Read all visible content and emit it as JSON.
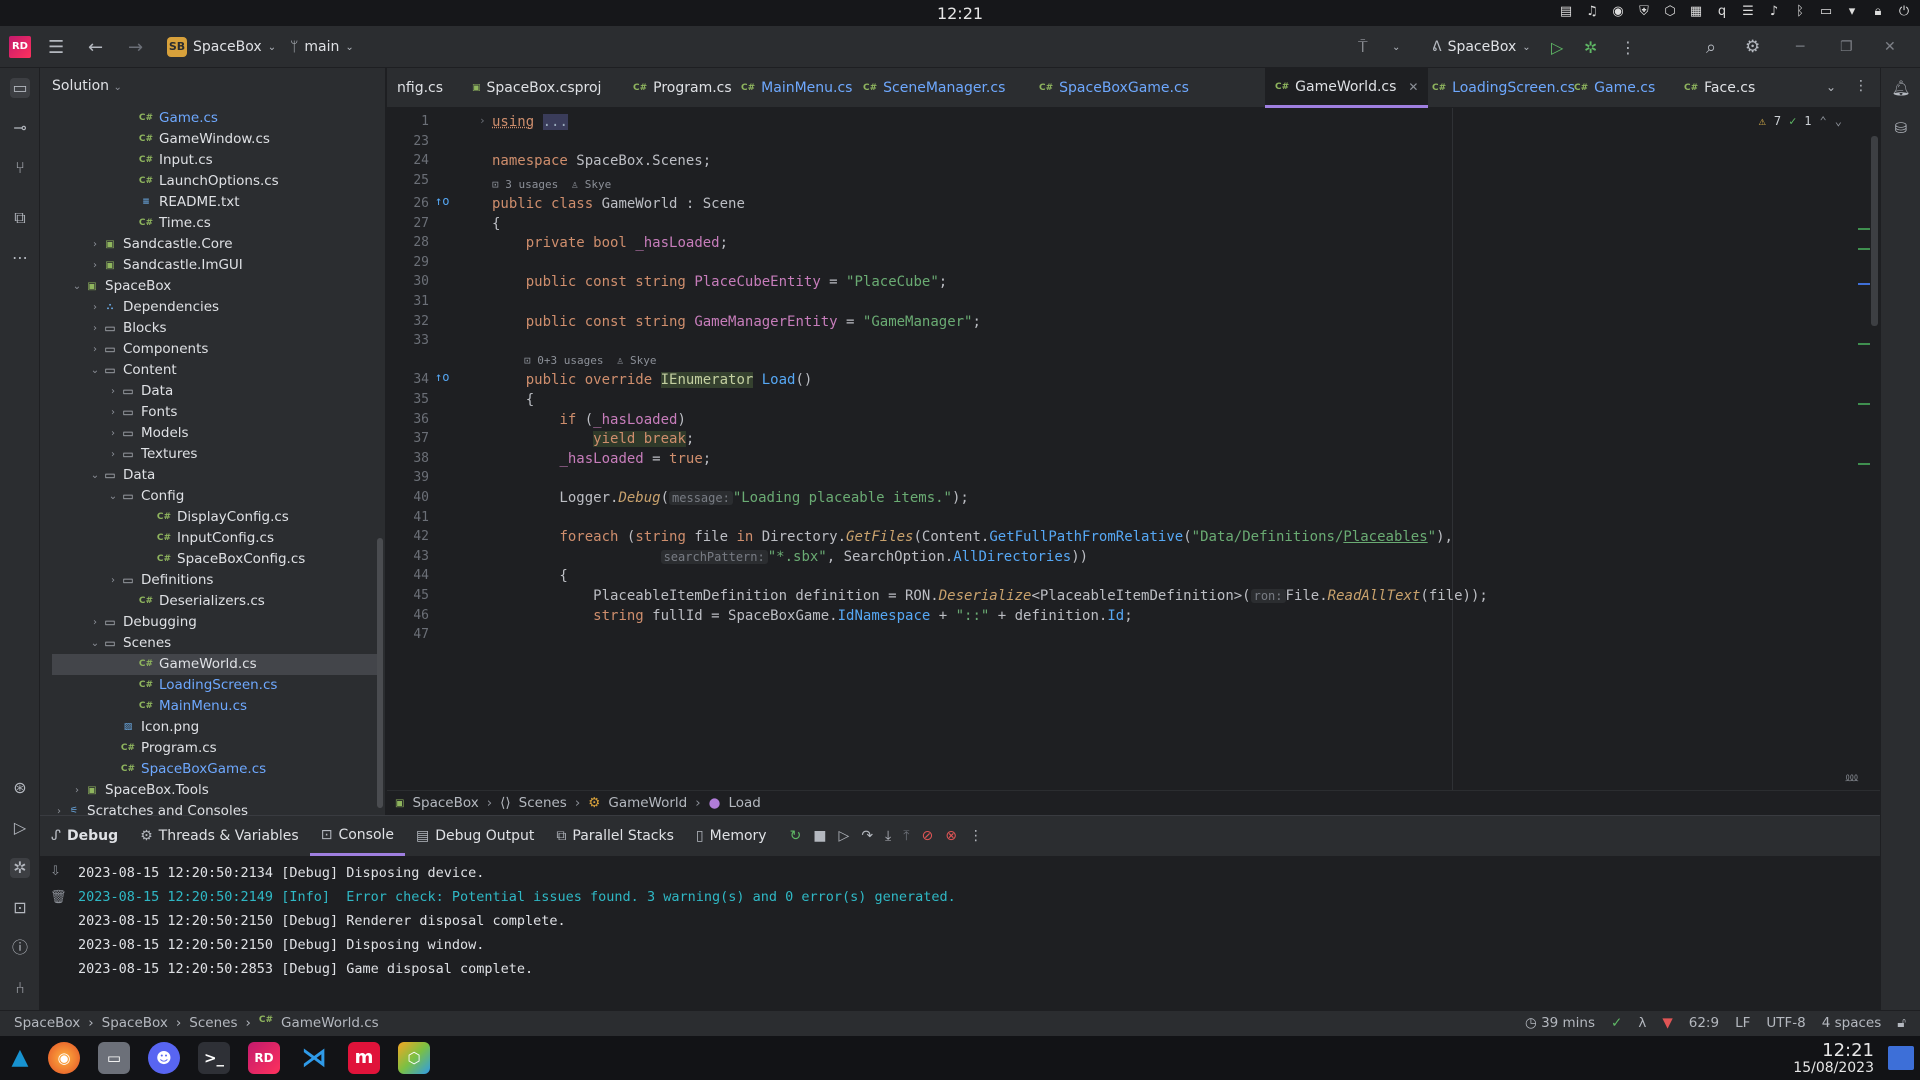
{
  "system": {
    "clock": "12:21"
  },
  "toolbar": {
    "app_logo": "RD",
    "project_badge": "SB",
    "project_name": "SpaceBox",
    "branch": "main",
    "run_config": "SpaceBox"
  },
  "solution": {
    "header": "Solution",
    "items": [
      {
        "label": "Game.cs",
        "type": "cs",
        "level": 3,
        "blue": true
      },
      {
        "label": "GameWindow.cs",
        "type": "cs",
        "level": 3
      },
      {
        "label": "Input.cs",
        "type": "cs",
        "level": 3
      },
      {
        "label": "LaunchOptions.cs",
        "type": "cs",
        "level": 3
      },
      {
        "label": "README.txt",
        "type": "txt",
        "level": 3
      },
      {
        "label": "Time.cs",
        "type": "cs",
        "level": 3
      },
      {
        "label": "Sandcastle.Core",
        "type": "proj",
        "level": 1,
        "chev": "right"
      },
      {
        "label": "Sandcastle.ImGUI",
        "type": "proj",
        "level": 1,
        "chev": "right"
      },
      {
        "label": "SpaceBox",
        "type": "proj",
        "level": 0,
        "chev": "down"
      },
      {
        "label": "Dependencies",
        "type": "deps",
        "level": 1,
        "chev": "right"
      },
      {
        "label": "Blocks",
        "type": "folder",
        "level": 1,
        "chev": "right"
      },
      {
        "label": "Components",
        "type": "folder",
        "level": 1,
        "chev": "right"
      },
      {
        "label": "Content",
        "type": "folder",
        "level": 1,
        "chev": "down"
      },
      {
        "label": "Data",
        "type": "folder",
        "level": 2,
        "chev": "right"
      },
      {
        "label": "Fonts",
        "type": "folder",
        "level": 2,
        "chev": "right"
      },
      {
        "label": "Models",
        "type": "folder",
        "level": 2,
        "chev": "right"
      },
      {
        "label": "Textures",
        "type": "folder",
        "level": 2,
        "chev": "right"
      },
      {
        "label": "Data",
        "type": "folder",
        "level": 1,
        "chev": "down"
      },
      {
        "label": "Config",
        "type": "folder",
        "level": 2,
        "chev": "down"
      },
      {
        "label": "DisplayConfig.cs",
        "type": "cs",
        "level": 4
      },
      {
        "label": "InputConfig.cs",
        "type": "cs",
        "level": 4
      },
      {
        "label": "SpaceBoxConfig.cs",
        "type": "cs",
        "level": 4
      },
      {
        "label": "Definitions",
        "type": "folder",
        "level": 2,
        "chev": "right"
      },
      {
        "label": "Deserializers.cs",
        "type": "cs",
        "level": 3
      },
      {
        "label": "Debugging",
        "type": "folder",
        "level": 1,
        "chev": "right"
      },
      {
        "label": "Scenes",
        "type": "folder",
        "level": 1,
        "chev": "down"
      },
      {
        "label": "GameWorld.cs",
        "type": "cs",
        "level": 3,
        "selected": true
      },
      {
        "label": "LoadingScreen.cs",
        "type": "cs",
        "level": 3,
        "blue": true
      },
      {
        "label": "MainMenu.cs",
        "type": "cs",
        "level": 3,
        "blue": true
      },
      {
        "label": "Icon.png",
        "type": "img",
        "level": 2
      },
      {
        "label": "Program.cs",
        "type": "cs",
        "level": 2
      },
      {
        "label": "SpaceBoxGame.cs",
        "type": "cs",
        "level": 2,
        "blue": true
      },
      {
        "label": "SpaceBox.Tools",
        "type": "proj",
        "level": 0,
        "chev": "right"
      },
      {
        "label": "Scratches and Consoles",
        "type": "scratch",
        "level": -1,
        "chev": "right"
      }
    ]
  },
  "tabs": [
    {
      "label": "nfig.cs",
      "blue": false
    },
    {
      "label": "SpaceBox.csproj",
      "blue": false
    },
    {
      "label": "Program.cs",
      "blue": false
    },
    {
      "label": "MainMenu.cs",
      "blue": true
    },
    {
      "label": "SceneManager.cs",
      "blue": true
    },
    {
      "label": "SpaceBoxGame.cs",
      "blue": true
    },
    {
      "label": "GameWorld.cs",
      "blue": false,
      "active": true
    },
    {
      "label": "LoadingScreen.cs",
      "blue": true
    },
    {
      "label": "Game.cs",
      "blue": true
    },
    {
      "label": "Face.cs",
      "blue": false
    }
  ],
  "editor": {
    "inspections": {
      "warnings": "7",
      "weak": "1"
    },
    "lens1": {
      "usages": "3 usages",
      "author": "Skye"
    },
    "lens2": {
      "usages": "0+3 usages",
      "author": "Skye"
    },
    "lines": [
      "1",
      "23",
      "24",
      "25",
      "26",
      "27",
      "28",
      "29",
      "30",
      "31",
      "32",
      "33",
      "34",
      "35",
      "36",
      "37",
      "38",
      "39",
      "40",
      "41",
      "42",
      "43",
      "44",
      "45",
      "46",
      "47"
    ]
  },
  "breadcrumb": [
    "SpaceBox",
    "Scenes",
    "GameWorld",
    "Load"
  ],
  "debug": {
    "tabs": [
      "Debug",
      "Threads & Variables",
      "Console",
      "Debug Output",
      "Parallel Stacks",
      "Memory"
    ],
    "console": [
      {
        "text": "2023-08-15 12:20:50:2134 [Debug] Disposing device.",
        "info": false
      },
      {
        "text": "2023-08-15 12:20:50:2149 [Info]  Error check: Potential issues found. 3 warning(s) and 0 error(s) generated.",
        "info": true
      },
      {
        "text": "2023-08-15 12:20:50:2150 [Debug] Renderer disposal complete.",
        "info": false
      },
      {
        "text": "2023-08-15 12:20:50:2150 [Debug] Disposing window.",
        "info": false
      },
      {
        "text": "2023-08-15 12:20:50:2853 [Debug] Game disposal complete.",
        "info": false
      }
    ]
  },
  "status": {
    "path": [
      "SpaceBox",
      "SpaceBox",
      "Scenes",
      "GameWorld.cs"
    ],
    "time": "39 mins",
    "position": "62:9",
    "line_ending": "LF",
    "encoding": "UTF-8",
    "indent": "4 spaces"
  },
  "taskbar": {
    "time": "12:21",
    "date": "15/08/2023",
    "rider_label": "RD",
    "jb_label": "m"
  }
}
